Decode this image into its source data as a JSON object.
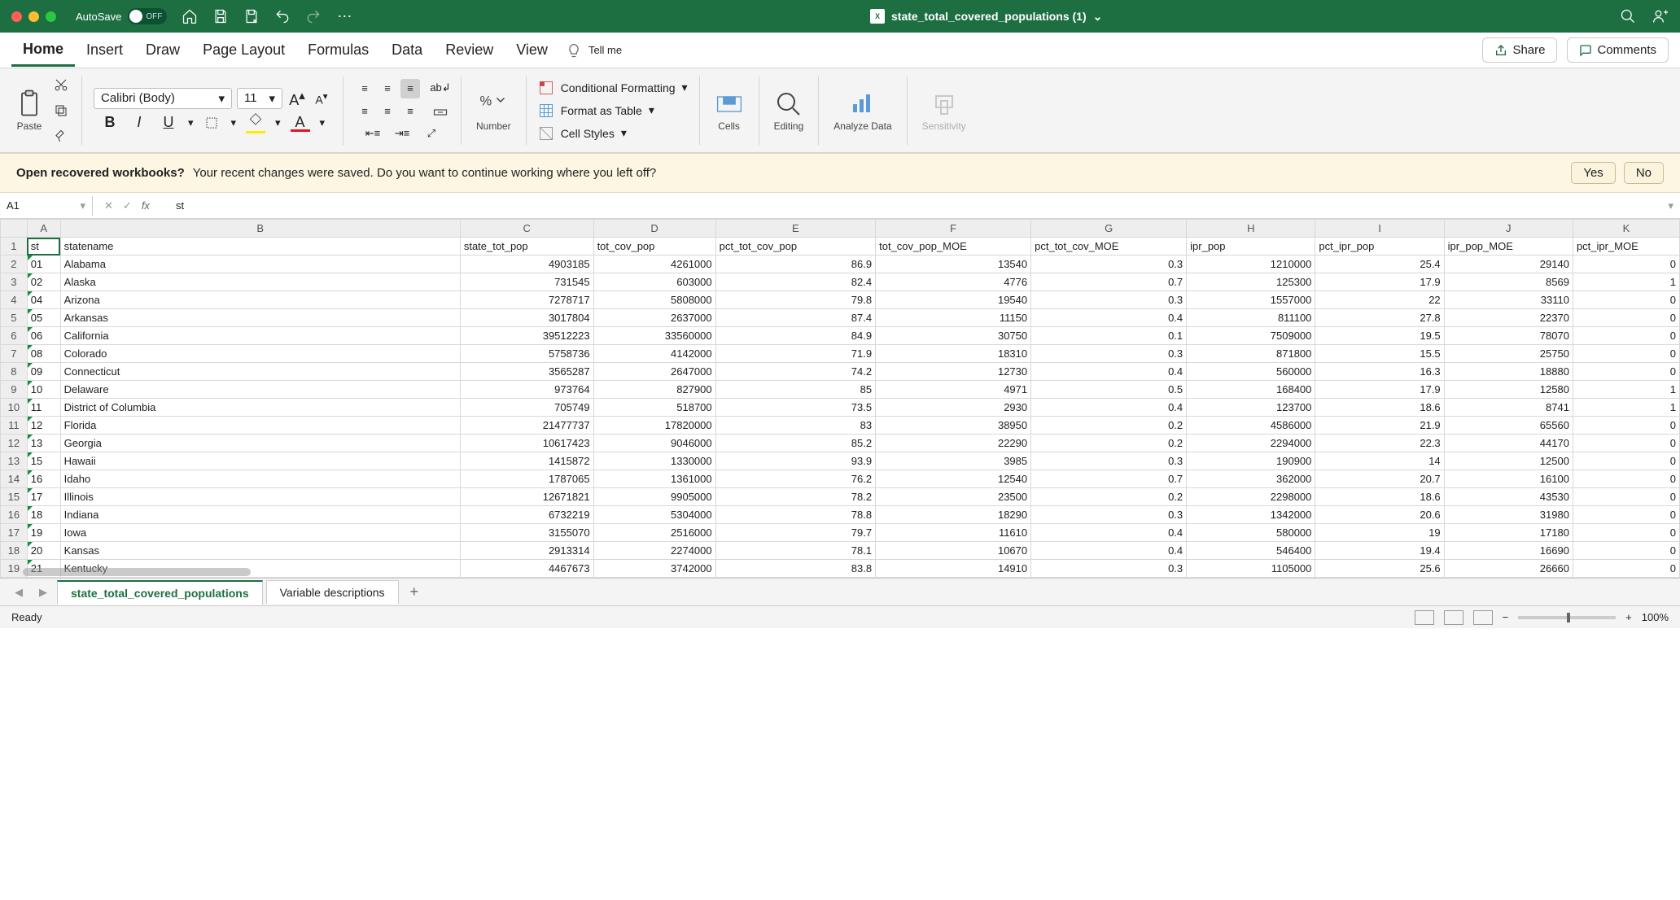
{
  "titlebar": {
    "autosave_label": "AutoSave",
    "autosave_state": "OFF",
    "doc_title": "state_total_covered_populations (1)"
  },
  "tabs": {
    "items": [
      "Home",
      "Insert",
      "Draw",
      "Page Layout",
      "Formulas",
      "Data",
      "Review",
      "View"
    ],
    "tellme": "Tell me",
    "share": "Share",
    "comments": "Comments"
  },
  "ribbon": {
    "paste": "Paste",
    "font_name": "Calibri (Body)",
    "font_size": "11",
    "number": "Number",
    "conditional_formatting": "Conditional Formatting",
    "format_as_table": "Format as Table",
    "cell_styles": "Cell Styles",
    "cells": "Cells",
    "editing": "Editing",
    "analyze": "Analyze Data",
    "sensitivity": "Sensitivity"
  },
  "recovered": {
    "title": "Open recovered workbooks?",
    "msg": "Your recent changes were saved. Do you want to continue working where you left off?",
    "yes": "Yes",
    "no": "No"
  },
  "formula_bar": {
    "namebox": "A1",
    "value": "st"
  },
  "columns": [
    "A",
    "B",
    "C",
    "D",
    "E",
    "F",
    "G",
    "H",
    "I",
    "J",
    "K"
  ],
  "headers": [
    "st",
    "statename",
    "state_tot_pop",
    "tot_cov_pop",
    "pct_tot_cov_pop",
    "tot_cov_pop_MOE",
    "pct_tot_cov_MOE",
    "ipr_pop",
    "pct_ipr_pop",
    "ipr_pop_MOE",
    "pct_ipr_MOE"
  ],
  "rows": [
    {
      "n": 2,
      "d": [
        "01",
        "Alabama",
        "4903185",
        "4261000",
        "86.9",
        "13540",
        "0.3",
        "1210000",
        "25.4",
        "29140",
        "0"
      ]
    },
    {
      "n": 3,
      "d": [
        "02",
        "Alaska",
        "731545",
        "603000",
        "82.4",
        "4776",
        "0.7",
        "125300",
        "17.9",
        "8569",
        "1"
      ]
    },
    {
      "n": 4,
      "d": [
        "04",
        "Arizona",
        "7278717",
        "5808000",
        "79.8",
        "19540",
        "0.3",
        "1557000",
        "22",
        "33110",
        "0"
      ]
    },
    {
      "n": 5,
      "d": [
        "05",
        "Arkansas",
        "3017804",
        "2637000",
        "87.4",
        "11150",
        "0.4",
        "811100",
        "27.8",
        "22370",
        "0"
      ]
    },
    {
      "n": 6,
      "d": [
        "06",
        "California",
        "39512223",
        "33560000",
        "84.9",
        "30750",
        "0.1",
        "7509000",
        "19.5",
        "78070",
        "0"
      ]
    },
    {
      "n": 7,
      "d": [
        "08",
        "Colorado",
        "5758736",
        "4142000",
        "71.9",
        "18310",
        "0.3",
        "871800",
        "15.5",
        "25750",
        "0"
      ]
    },
    {
      "n": 8,
      "d": [
        "09",
        "Connecticut",
        "3565287",
        "2647000",
        "74.2",
        "12730",
        "0.4",
        "560000",
        "16.3",
        "18880",
        "0"
      ]
    },
    {
      "n": 9,
      "d": [
        "10",
        "Delaware",
        "973764",
        "827900",
        "85",
        "4971",
        "0.5",
        "168400",
        "17.9",
        "12580",
        "1"
      ]
    },
    {
      "n": 10,
      "d": [
        "11",
        "District of Columbia",
        "705749",
        "518700",
        "73.5",
        "2930",
        "0.4",
        "123700",
        "18.6",
        "8741",
        "1"
      ]
    },
    {
      "n": 11,
      "d": [
        "12",
        "Florida",
        "21477737",
        "17820000",
        "83",
        "38950",
        "0.2",
        "4586000",
        "21.9",
        "65560",
        "0"
      ]
    },
    {
      "n": 12,
      "d": [
        "13",
        "Georgia",
        "10617423",
        "9046000",
        "85.2",
        "22290",
        "0.2",
        "2294000",
        "22.3",
        "44170",
        "0"
      ]
    },
    {
      "n": 13,
      "d": [
        "15",
        "Hawaii",
        "1415872",
        "1330000",
        "93.9",
        "3985",
        "0.3",
        "190900",
        "14",
        "12500",
        "0"
      ]
    },
    {
      "n": 14,
      "d": [
        "16",
        "Idaho",
        "1787065",
        "1361000",
        "76.2",
        "12540",
        "0.7",
        "362000",
        "20.7",
        "16100",
        "0"
      ]
    },
    {
      "n": 15,
      "d": [
        "17",
        "Illinois",
        "12671821",
        "9905000",
        "78.2",
        "23500",
        "0.2",
        "2298000",
        "18.6",
        "43530",
        "0"
      ]
    },
    {
      "n": 16,
      "d": [
        "18",
        "Indiana",
        "6732219",
        "5304000",
        "78.8",
        "18290",
        "0.3",
        "1342000",
        "20.6",
        "31980",
        "0"
      ]
    },
    {
      "n": 17,
      "d": [
        "19",
        "Iowa",
        "3155070",
        "2516000",
        "79.7",
        "11610",
        "0.4",
        "580000",
        "19",
        "17180",
        "0"
      ]
    },
    {
      "n": 18,
      "d": [
        "20",
        "Kansas",
        "2913314",
        "2274000",
        "78.1",
        "10670",
        "0.4",
        "546400",
        "19.4",
        "16690",
        "0"
      ]
    },
    {
      "n": 19,
      "d": [
        "21",
        "Kentucky",
        "4467673",
        "3742000",
        "83.8",
        "14910",
        "0.3",
        "1105000",
        "25.6",
        "26660",
        "0"
      ]
    }
  ],
  "sheets": {
    "active": "state_total_covered_populations",
    "inactive": "Variable descriptions"
  },
  "statusbar": {
    "ready": "Ready",
    "zoom": "100%"
  }
}
